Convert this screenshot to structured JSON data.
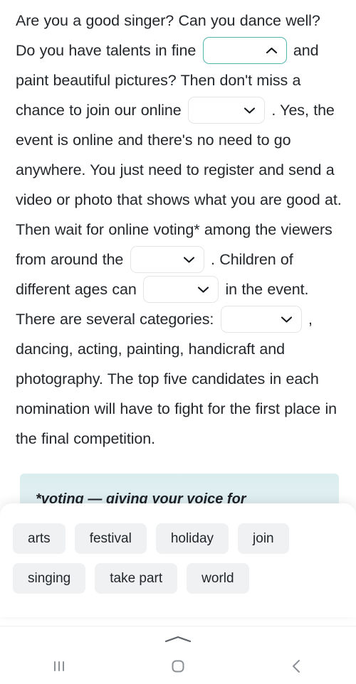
{
  "exercise": {
    "segments": [
      {
        "type": "text",
        "value": "Are you a good singer? Can you dance well? Do you have talents in fine "
      },
      {
        "type": "gap",
        "id": "gap-1",
        "state": "open",
        "icon": "chevron-up-icon",
        "value": ""
      },
      {
        "type": "text",
        "value": " and paint beautiful pictures? Then don't miss a chance to join our online "
      },
      {
        "type": "gap",
        "id": "gap-2",
        "state": "closed",
        "icon": "chevron-down-icon",
        "value": ""
      },
      {
        "type": "text",
        "value": " . Yes, the event is online and there's no need to go anywhere. You just need to register and send a video or photo that shows what you are good at. Then wait for online voting* among the viewers from around the "
      },
      {
        "type": "gap",
        "id": "gap-3",
        "state": "closed",
        "icon": "chevron-down-icon",
        "value": ""
      },
      {
        "type": "text",
        "value": " . Children of different ages can "
      },
      {
        "type": "gap",
        "id": "gap-4",
        "state": "closed",
        "icon": "chevron-down-icon",
        "value": ""
      },
      {
        "type": "text",
        "value": " in the event. There are several categories: "
      },
      {
        "type": "gap",
        "id": "gap-5",
        "state": "closed",
        "icon": "chevron-down-icon",
        "value": ""
      },
      {
        "type": "text",
        "value": " , dancing, acting, painting, handicraft and photography. The top five candidates in each nomination will have to fight for the first place in the final competition."
      }
    ],
    "parts": {
      "p1": "Are you a good singer? Can you dance well? Do you have talents in fine ",
      "p2": " and paint beautiful pictures? Then don't miss a chance to join our online ",
      "p3": " . Yes, the event is online and there's no need to go anywhere. You just need to register and send a video or photo that shows what you are good at. Then wait for online voting* among the viewers from around the ",
      "p4": " . Children of different ages can ",
      "p5": " in the event. There are several categories: ",
      "p6": " , dancing, acting, painting, handicraft and photography. The top five candidates in each nomination will have to fight for the first place in the final competition."
    }
  },
  "callout": {
    "text": "*voting — giving your voice for"
  },
  "suggestions": {
    "row1": [
      "arts",
      "festival",
      "holiday",
      "join"
    ],
    "row2": [
      "singing",
      "take part",
      "world"
    ]
  },
  "navbar": {
    "handle_icon": "chevron-up-icon",
    "recents_icon": "recents-icon",
    "home_icon": "home-icon",
    "back_icon": "back-icon"
  },
  "colors": {
    "accent_teal": "#53b5b0",
    "gap_border": "#e3e5e8",
    "chip_bg": "#f0f1f3",
    "callout_bg": "#dcedf0",
    "text": "#23272b"
  }
}
